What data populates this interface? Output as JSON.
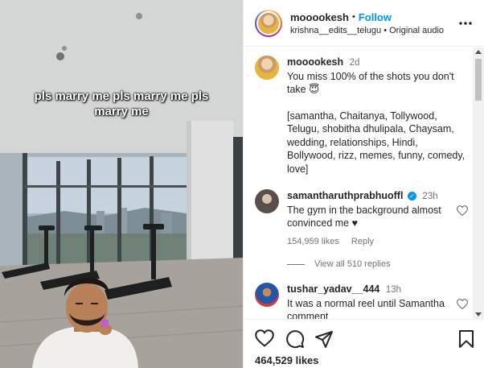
{
  "media": {
    "caption": "pls marry me pls marry me pls marry me"
  },
  "header": {
    "username": "mooookesh",
    "separator": "•",
    "follow_label": "Follow",
    "audio_user": "krishna__edits__telugu",
    "audio_label": "Original audio",
    "more_icon": "more-horizontal-icon"
  },
  "comments": [
    {
      "username": "mooookesh",
      "time": "2d",
      "text": "You miss 100% of the shots you don't take 😇",
      "tags": "[samantha, Chaitanya, Tollywood, Telugu, shobitha dhulipala, Chaysam, wedding, relationships, Hindi, Bollywood, rizz, memes, funny, comedy, love]"
    },
    {
      "username": "samantharuthprabhuoffl",
      "verified": true,
      "time": "23h",
      "text": "The gym in the background almost convinced me ♥",
      "likes": "154,959 likes",
      "reply": "Reply",
      "view_replies": "View all 510 replies"
    },
    {
      "username": "tushar_yadav__444",
      "time": "13h",
      "text": "It was a normal reel until Samantha comment"
    }
  ],
  "footer": {
    "likes": "464,529 likes",
    "icons": [
      "heart-icon",
      "comment-icon",
      "share-icon",
      "bookmark-icon"
    ]
  },
  "colors": {
    "accent": "#0095f6",
    "text": "#262626",
    "muted": "#737373"
  }
}
